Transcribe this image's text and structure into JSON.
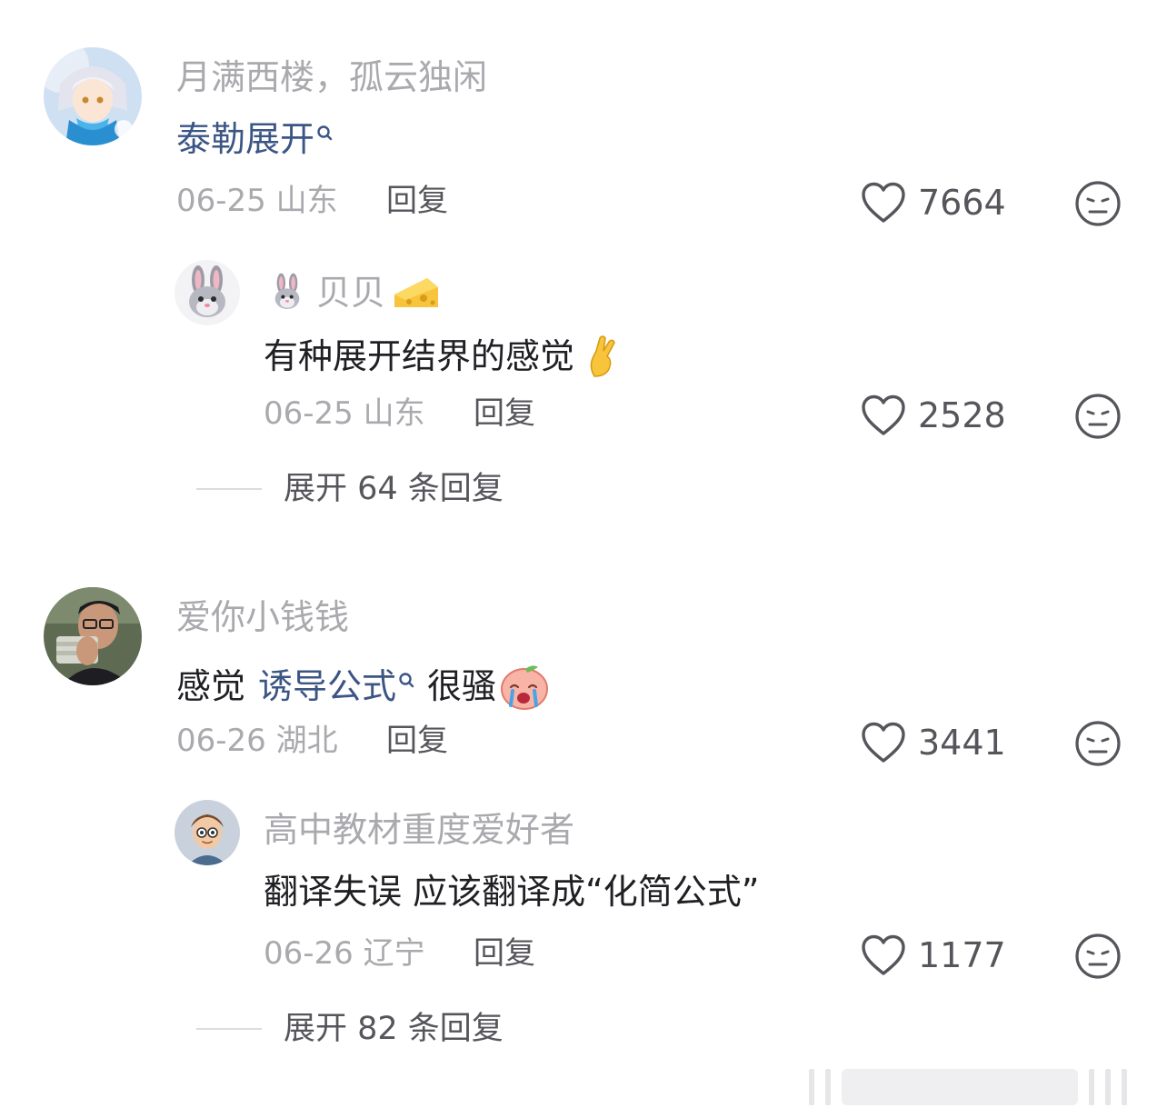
{
  "comments": [
    {
      "username": "月满西楼，孤云独闲",
      "text_link": "泰勒展开",
      "date": "06-25",
      "location": "山东",
      "reply_label": "回复",
      "likes": "7664",
      "replies": [
        {
          "username": "贝贝",
          "text": "有种展开结界的感觉",
          "date": "06-25",
          "location": "山东",
          "reply_label": "回复",
          "likes": "2528"
        }
      ],
      "expand_label": "展开 64 条回复"
    },
    {
      "username": "爱你小钱钱",
      "text_before": "感觉",
      "text_link": "诱导公式",
      "text_after": "很骚",
      "date": "06-26",
      "location": "湖北",
      "reply_label": "回复",
      "likes": "3441",
      "replies": [
        {
          "username": "高中教材重度爱好者",
          "text": "翻译失误 应该翻译成“化简公式”",
          "date": "06-26",
          "location": "辽宁",
          "reply_label": "回复",
          "likes": "1177"
        }
      ],
      "expand_label": "展开 82 条回复"
    }
  ],
  "icons": {
    "like": "heart-outline-icon",
    "dislike": "neutral-face-icon",
    "search": "search-icon"
  },
  "colors": {
    "link": "#3b5585",
    "username": "#a9a9ae",
    "text": "#1f1f24",
    "secondary": "#55555b"
  }
}
